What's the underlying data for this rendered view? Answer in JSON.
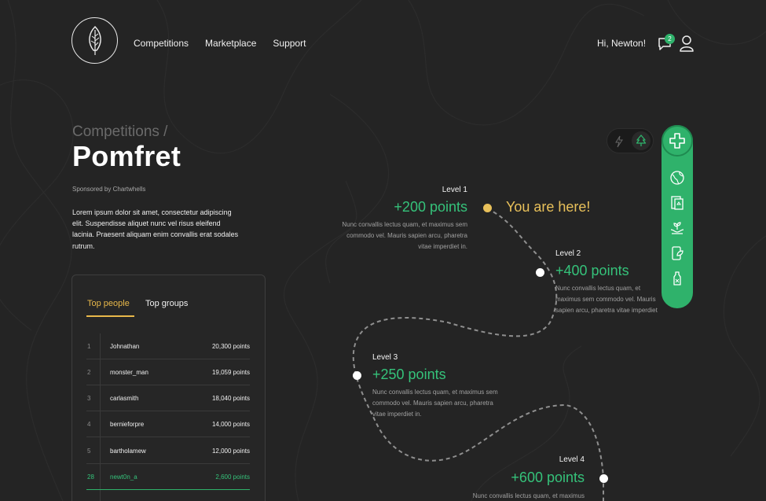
{
  "header": {
    "nav": [
      "Competitions",
      "Marketplace",
      "Support"
    ],
    "greeting": "Hi, Newton!",
    "notifications": "2"
  },
  "hero": {
    "breadcrumb": "Competitions /",
    "title": "Pomfret",
    "sponsor": "Sponsored by Chartwhells",
    "description": "Lorem ipsum dolor sit amet, consectetur adipiscing elit. Suspendisse aliquet nunc vel risus eleifend lacinia. Praesent aliquam enim convallis erat sodales rutrum."
  },
  "leaderboard": {
    "tabs": [
      "Top people",
      "Top groups"
    ],
    "rows": [
      {
        "rank": "1",
        "name": "Johnathan",
        "points": "20,300 points"
      },
      {
        "rank": "2",
        "name": "monster_man",
        "points": "19,059 points"
      },
      {
        "rank": "3",
        "name": "carlasmith",
        "points": "18,040 points"
      },
      {
        "rank": "4",
        "name": "bernieforpre",
        "points": "14,000 points"
      },
      {
        "rank": "5",
        "name": "bartholamew",
        "points": "12,000 points"
      },
      {
        "rank": "28",
        "name": "newt0n_a",
        "points": "2,600 points"
      }
    ]
  },
  "levels": [
    {
      "name": "Level 1",
      "points": "+200 points",
      "desc": "Nunc convallis lectus quam, et maximus sem commodo vel. Mauris sapien arcu, pharetra vitae imperdiet in."
    },
    {
      "name": "Level 2",
      "points": "+400 points",
      "desc": "Nunc convallis lectus quam, et maximus sem commodo vel. Mauris sapien arcu, pharetra vitae imperdiet in."
    },
    {
      "name": "Level 3",
      "points": "+250 points",
      "desc": "Nunc convallis lectus quam, et maximus sem commodo vel. Mauris sapien arcu, pharetra vitae imperdiet in."
    },
    {
      "name": "Level 4",
      "points": "+600 points",
      "desc": "Nunc convallis lectus quam, et maximus"
    }
  ],
  "you_are_here": "You are here!",
  "colors": {
    "accent_green": "#2fb26b",
    "accent_yellow": "#e8c05a",
    "background": "#242424"
  }
}
